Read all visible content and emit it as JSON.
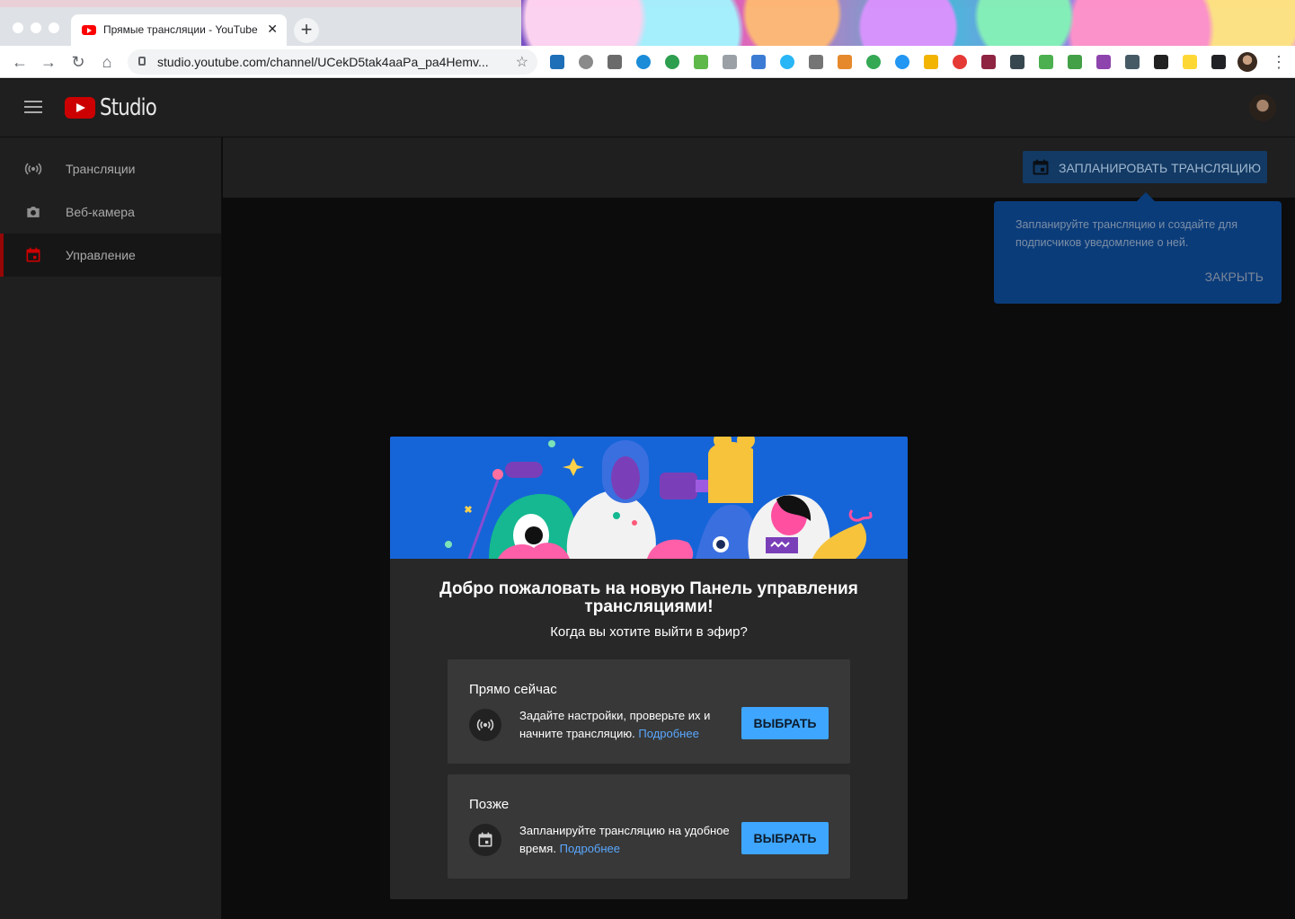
{
  "browser": {
    "tab_title": "Прямые трансляции - YouTube",
    "tab_close": "✕",
    "new_tab": "+",
    "url": "studio.youtube.com/channel/UCekD5tak4aaPa_pa4Hemv...",
    "nav": {
      "back": "←",
      "forward": "→",
      "reload": "↻",
      "home": "⌂",
      "star": "☆",
      "menu": "⋮"
    }
  },
  "app": {
    "logo_text": "Studio"
  },
  "sidebar": {
    "items": [
      {
        "label": "Трансляции",
        "icon": "broadcast-icon"
      },
      {
        "label": "Веб-камера",
        "icon": "camera-icon"
      },
      {
        "label": "Управление",
        "icon": "calendar-icon",
        "active": true
      }
    ]
  },
  "header": {
    "schedule_button": "ЗАПЛАНИРОВАТЬ ТРАНСЛЯЦИЮ"
  },
  "tooltip": {
    "text": "Запланируйте трансляцию и создайте для подписчиков уведомление о ней.",
    "close": "ЗАКРЫТЬ"
  },
  "dialog": {
    "title": "Добро пожаловать на новую Панель управления трансляциями!",
    "subtitle": "Когда вы хотите выйти в эфир?",
    "options": [
      {
        "heading": "Прямо сейчас",
        "description": "Задайте настройки, проверьте их и начните трансляцию.",
        "link": "Подробнее",
        "button": "ВЫБРАТЬ",
        "icon": "broadcast-icon"
      },
      {
        "heading": "Позже",
        "description": "Запланируйте трансляцию на удобное время.",
        "link": "Подробнее",
        "button": "ВЫБРАТЬ",
        "icon": "calendar-icon"
      }
    ]
  },
  "colors": {
    "accent": "#3ea6ff",
    "brand_red": "#cc0000",
    "tooltip_bg": "#0b3c7a",
    "banner_bg": "#1565d8"
  }
}
